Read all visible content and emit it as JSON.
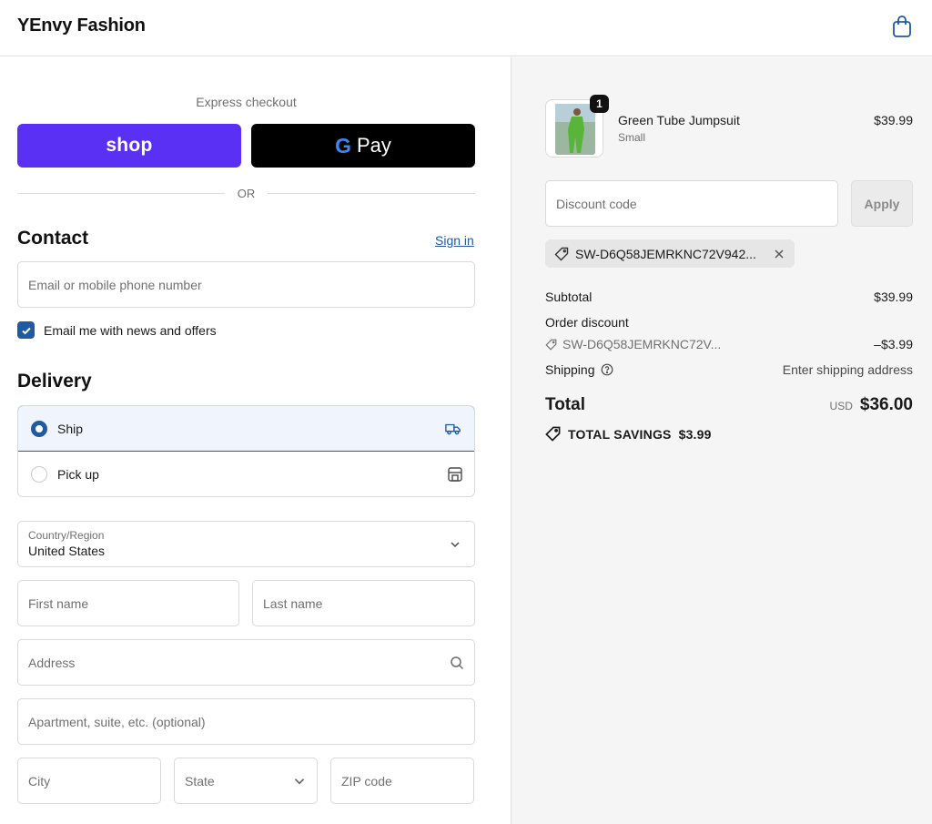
{
  "header": {
    "brand": "YEnvy Fashion",
    "cart_icon": "shopping-bag-icon"
  },
  "express": {
    "title": "Express checkout",
    "shop_label": "shop",
    "gpay_g": "G",
    "gpay_label": "Pay",
    "or_label": "OR"
  },
  "contact": {
    "heading": "Contact",
    "sign_in": "Sign in",
    "email_placeholder": "Email or mobile phone number",
    "newsletter_label": "Email me with news and offers",
    "newsletter_checked": true
  },
  "delivery": {
    "heading": "Delivery",
    "options": [
      {
        "label": "Ship",
        "selected": true,
        "icon": "truck-icon"
      },
      {
        "label": "Pick up",
        "selected": false,
        "icon": "store-icon"
      }
    ],
    "country_label": "Country/Region",
    "country_value": "United States",
    "first_name": "First name",
    "last_name": "Last name",
    "address": "Address",
    "apartment": "Apartment, suite, etc. (optional)",
    "city": "City",
    "state": "State",
    "zip": "ZIP code"
  },
  "summary": {
    "product": {
      "name": "Green Tube Jumpsuit",
      "variant": "Small",
      "price": "$39.99",
      "quantity": "1"
    },
    "discount_placeholder": "Discount code",
    "apply_label": "Apply",
    "applied_code": "SW-D6Q58JEMRKNC72V942...",
    "subtotal_label": "Subtotal",
    "subtotal_value": "$39.99",
    "order_discount_label": "Order discount",
    "order_discount_code": "SW-D6Q58JEMRKNC72V...",
    "order_discount_value": "–$3.99",
    "shipping_label": "Shipping",
    "shipping_value": "Enter shipping address",
    "total_label": "Total",
    "total_currency": "USD",
    "total_value": "$36.00",
    "savings_label": "TOTAL SAVINGS",
    "savings_value": "$3.99"
  },
  "colors": {
    "accent": "#1f5aa3",
    "shop_purple": "#5a31f4",
    "panel_bg": "#f5f5f5"
  }
}
